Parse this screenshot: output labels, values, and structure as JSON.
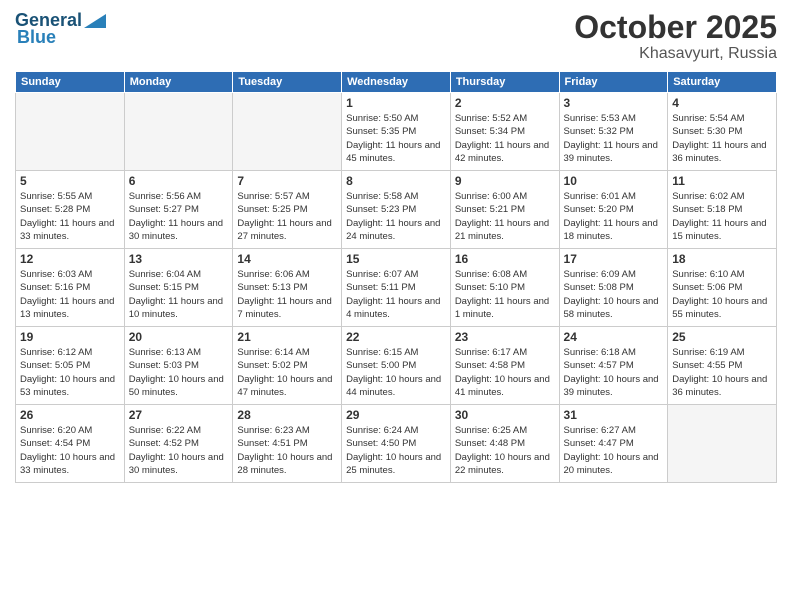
{
  "header": {
    "logo_line1": "General",
    "logo_line2": "Blue",
    "month": "October 2025",
    "location": "Khasavyurt, Russia"
  },
  "days_of_week": [
    "Sunday",
    "Monday",
    "Tuesday",
    "Wednesday",
    "Thursday",
    "Friday",
    "Saturday"
  ],
  "weeks": [
    [
      {
        "day": "",
        "info": ""
      },
      {
        "day": "",
        "info": ""
      },
      {
        "day": "",
        "info": ""
      },
      {
        "day": "1",
        "info": "Sunrise: 5:50 AM\nSunset: 5:35 PM\nDaylight: 11 hours and 45 minutes."
      },
      {
        "day": "2",
        "info": "Sunrise: 5:52 AM\nSunset: 5:34 PM\nDaylight: 11 hours and 42 minutes."
      },
      {
        "day": "3",
        "info": "Sunrise: 5:53 AM\nSunset: 5:32 PM\nDaylight: 11 hours and 39 minutes."
      },
      {
        "day": "4",
        "info": "Sunrise: 5:54 AM\nSunset: 5:30 PM\nDaylight: 11 hours and 36 minutes."
      }
    ],
    [
      {
        "day": "5",
        "info": "Sunrise: 5:55 AM\nSunset: 5:28 PM\nDaylight: 11 hours and 33 minutes."
      },
      {
        "day": "6",
        "info": "Sunrise: 5:56 AM\nSunset: 5:27 PM\nDaylight: 11 hours and 30 minutes."
      },
      {
        "day": "7",
        "info": "Sunrise: 5:57 AM\nSunset: 5:25 PM\nDaylight: 11 hours and 27 minutes."
      },
      {
        "day": "8",
        "info": "Sunrise: 5:58 AM\nSunset: 5:23 PM\nDaylight: 11 hours and 24 minutes."
      },
      {
        "day": "9",
        "info": "Sunrise: 6:00 AM\nSunset: 5:21 PM\nDaylight: 11 hours and 21 minutes."
      },
      {
        "day": "10",
        "info": "Sunrise: 6:01 AM\nSunset: 5:20 PM\nDaylight: 11 hours and 18 minutes."
      },
      {
        "day": "11",
        "info": "Sunrise: 6:02 AM\nSunset: 5:18 PM\nDaylight: 11 hours and 15 minutes."
      }
    ],
    [
      {
        "day": "12",
        "info": "Sunrise: 6:03 AM\nSunset: 5:16 PM\nDaylight: 11 hours and 13 minutes."
      },
      {
        "day": "13",
        "info": "Sunrise: 6:04 AM\nSunset: 5:15 PM\nDaylight: 11 hours and 10 minutes."
      },
      {
        "day": "14",
        "info": "Sunrise: 6:06 AM\nSunset: 5:13 PM\nDaylight: 11 hours and 7 minutes."
      },
      {
        "day": "15",
        "info": "Sunrise: 6:07 AM\nSunset: 5:11 PM\nDaylight: 11 hours and 4 minutes."
      },
      {
        "day": "16",
        "info": "Sunrise: 6:08 AM\nSunset: 5:10 PM\nDaylight: 11 hours and 1 minute."
      },
      {
        "day": "17",
        "info": "Sunrise: 6:09 AM\nSunset: 5:08 PM\nDaylight: 10 hours and 58 minutes."
      },
      {
        "day": "18",
        "info": "Sunrise: 6:10 AM\nSunset: 5:06 PM\nDaylight: 10 hours and 55 minutes."
      }
    ],
    [
      {
        "day": "19",
        "info": "Sunrise: 6:12 AM\nSunset: 5:05 PM\nDaylight: 10 hours and 53 minutes."
      },
      {
        "day": "20",
        "info": "Sunrise: 6:13 AM\nSunset: 5:03 PM\nDaylight: 10 hours and 50 minutes."
      },
      {
        "day": "21",
        "info": "Sunrise: 6:14 AM\nSunset: 5:02 PM\nDaylight: 10 hours and 47 minutes."
      },
      {
        "day": "22",
        "info": "Sunrise: 6:15 AM\nSunset: 5:00 PM\nDaylight: 10 hours and 44 minutes."
      },
      {
        "day": "23",
        "info": "Sunrise: 6:17 AM\nSunset: 4:58 PM\nDaylight: 10 hours and 41 minutes."
      },
      {
        "day": "24",
        "info": "Sunrise: 6:18 AM\nSunset: 4:57 PM\nDaylight: 10 hours and 39 minutes."
      },
      {
        "day": "25",
        "info": "Sunrise: 6:19 AM\nSunset: 4:55 PM\nDaylight: 10 hours and 36 minutes."
      }
    ],
    [
      {
        "day": "26",
        "info": "Sunrise: 6:20 AM\nSunset: 4:54 PM\nDaylight: 10 hours and 33 minutes."
      },
      {
        "day": "27",
        "info": "Sunrise: 6:22 AM\nSunset: 4:52 PM\nDaylight: 10 hours and 30 minutes."
      },
      {
        "day": "28",
        "info": "Sunrise: 6:23 AM\nSunset: 4:51 PM\nDaylight: 10 hours and 28 minutes."
      },
      {
        "day": "29",
        "info": "Sunrise: 6:24 AM\nSunset: 4:50 PM\nDaylight: 10 hours and 25 minutes."
      },
      {
        "day": "30",
        "info": "Sunrise: 6:25 AM\nSunset: 4:48 PM\nDaylight: 10 hours and 22 minutes."
      },
      {
        "day": "31",
        "info": "Sunrise: 6:27 AM\nSunset: 4:47 PM\nDaylight: 10 hours and 20 minutes."
      },
      {
        "day": "",
        "info": ""
      }
    ]
  ]
}
